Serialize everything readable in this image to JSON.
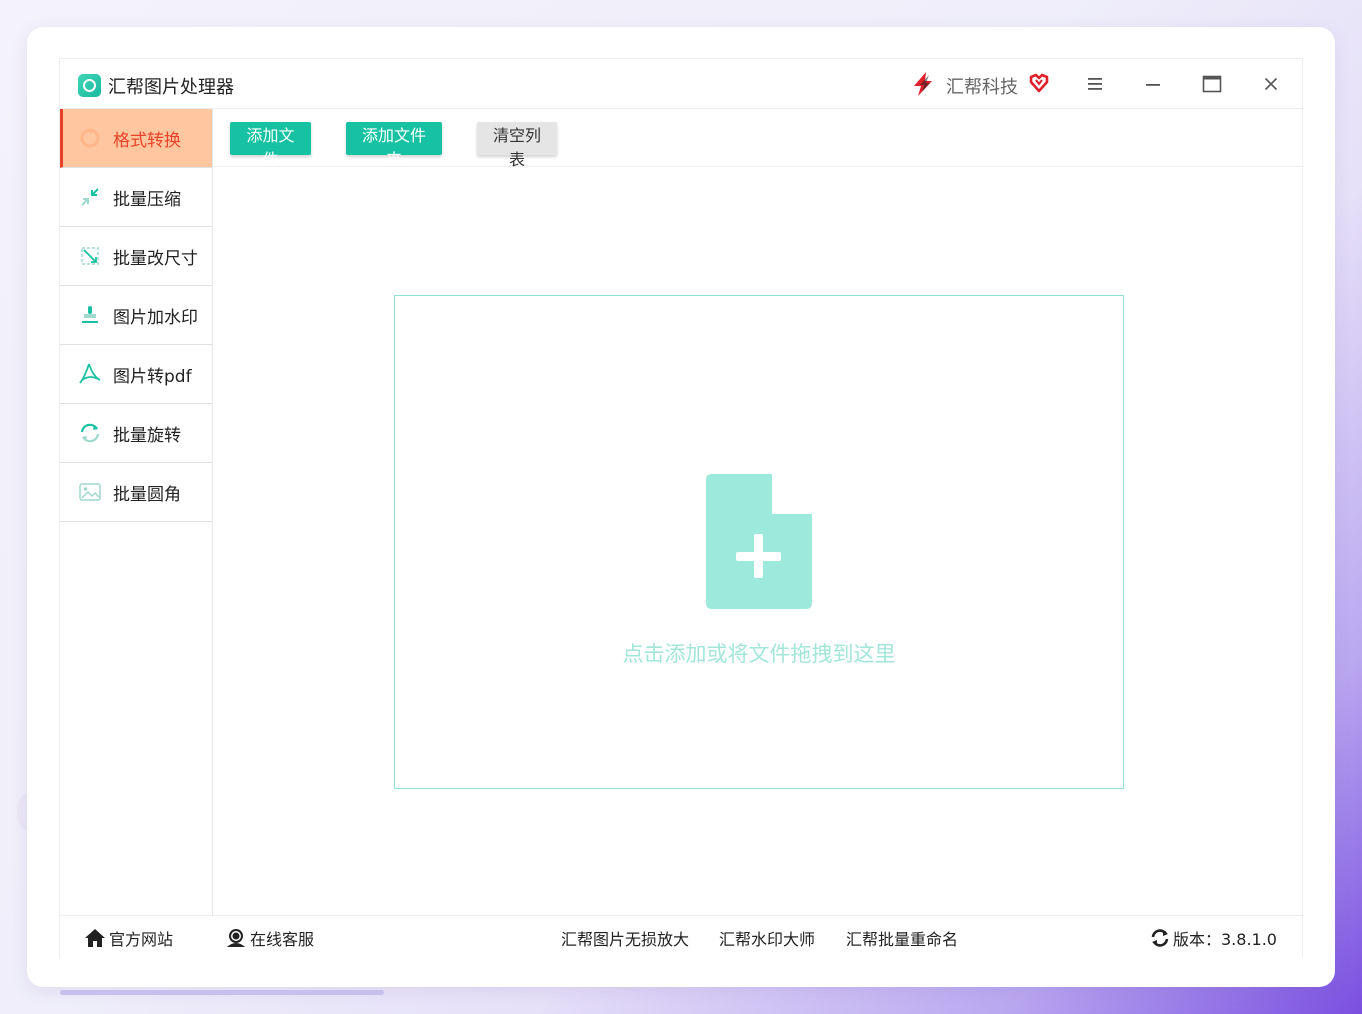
{
  "app": {
    "title": "汇帮图片处理器"
  },
  "brand": {
    "name": "汇帮科技"
  },
  "sidebar": {
    "items": [
      {
        "label": "格式转换",
        "icon": "format-convert-icon",
        "active": true
      },
      {
        "label": "批量压缩",
        "icon": "compress-icon"
      },
      {
        "label": "批量改尺寸",
        "icon": "resize-icon"
      },
      {
        "label": "图片加水印",
        "icon": "watermark-stamp-icon"
      },
      {
        "label": "图片转pdf",
        "icon": "pdf-icon"
      },
      {
        "label": "批量旋转",
        "icon": "rotate-icon"
      },
      {
        "label": "批量圆角",
        "icon": "image-rounded-icon"
      }
    ]
  },
  "toolbar": {
    "add_file": "添加文件",
    "add_folder": "添加文件夹",
    "clear_list": "清空列表"
  },
  "dropzone": {
    "text": "点击添加或将文件拖拽到这里"
  },
  "footer": {
    "official_site": "官方网站",
    "online_service": "在线客服",
    "enlarge": "汇帮图片无损放大",
    "watermark_master": "汇帮水印大师",
    "batch_rename": "汇帮批量重命名",
    "version": "版本：3.8.1.0"
  },
  "colors": {
    "accent": "#17c2a3",
    "active_bg": "#ffc7a0",
    "active_text": "#e8422b",
    "drop_border": "#8fe0d2",
    "drop_text": "#a2e6da"
  }
}
